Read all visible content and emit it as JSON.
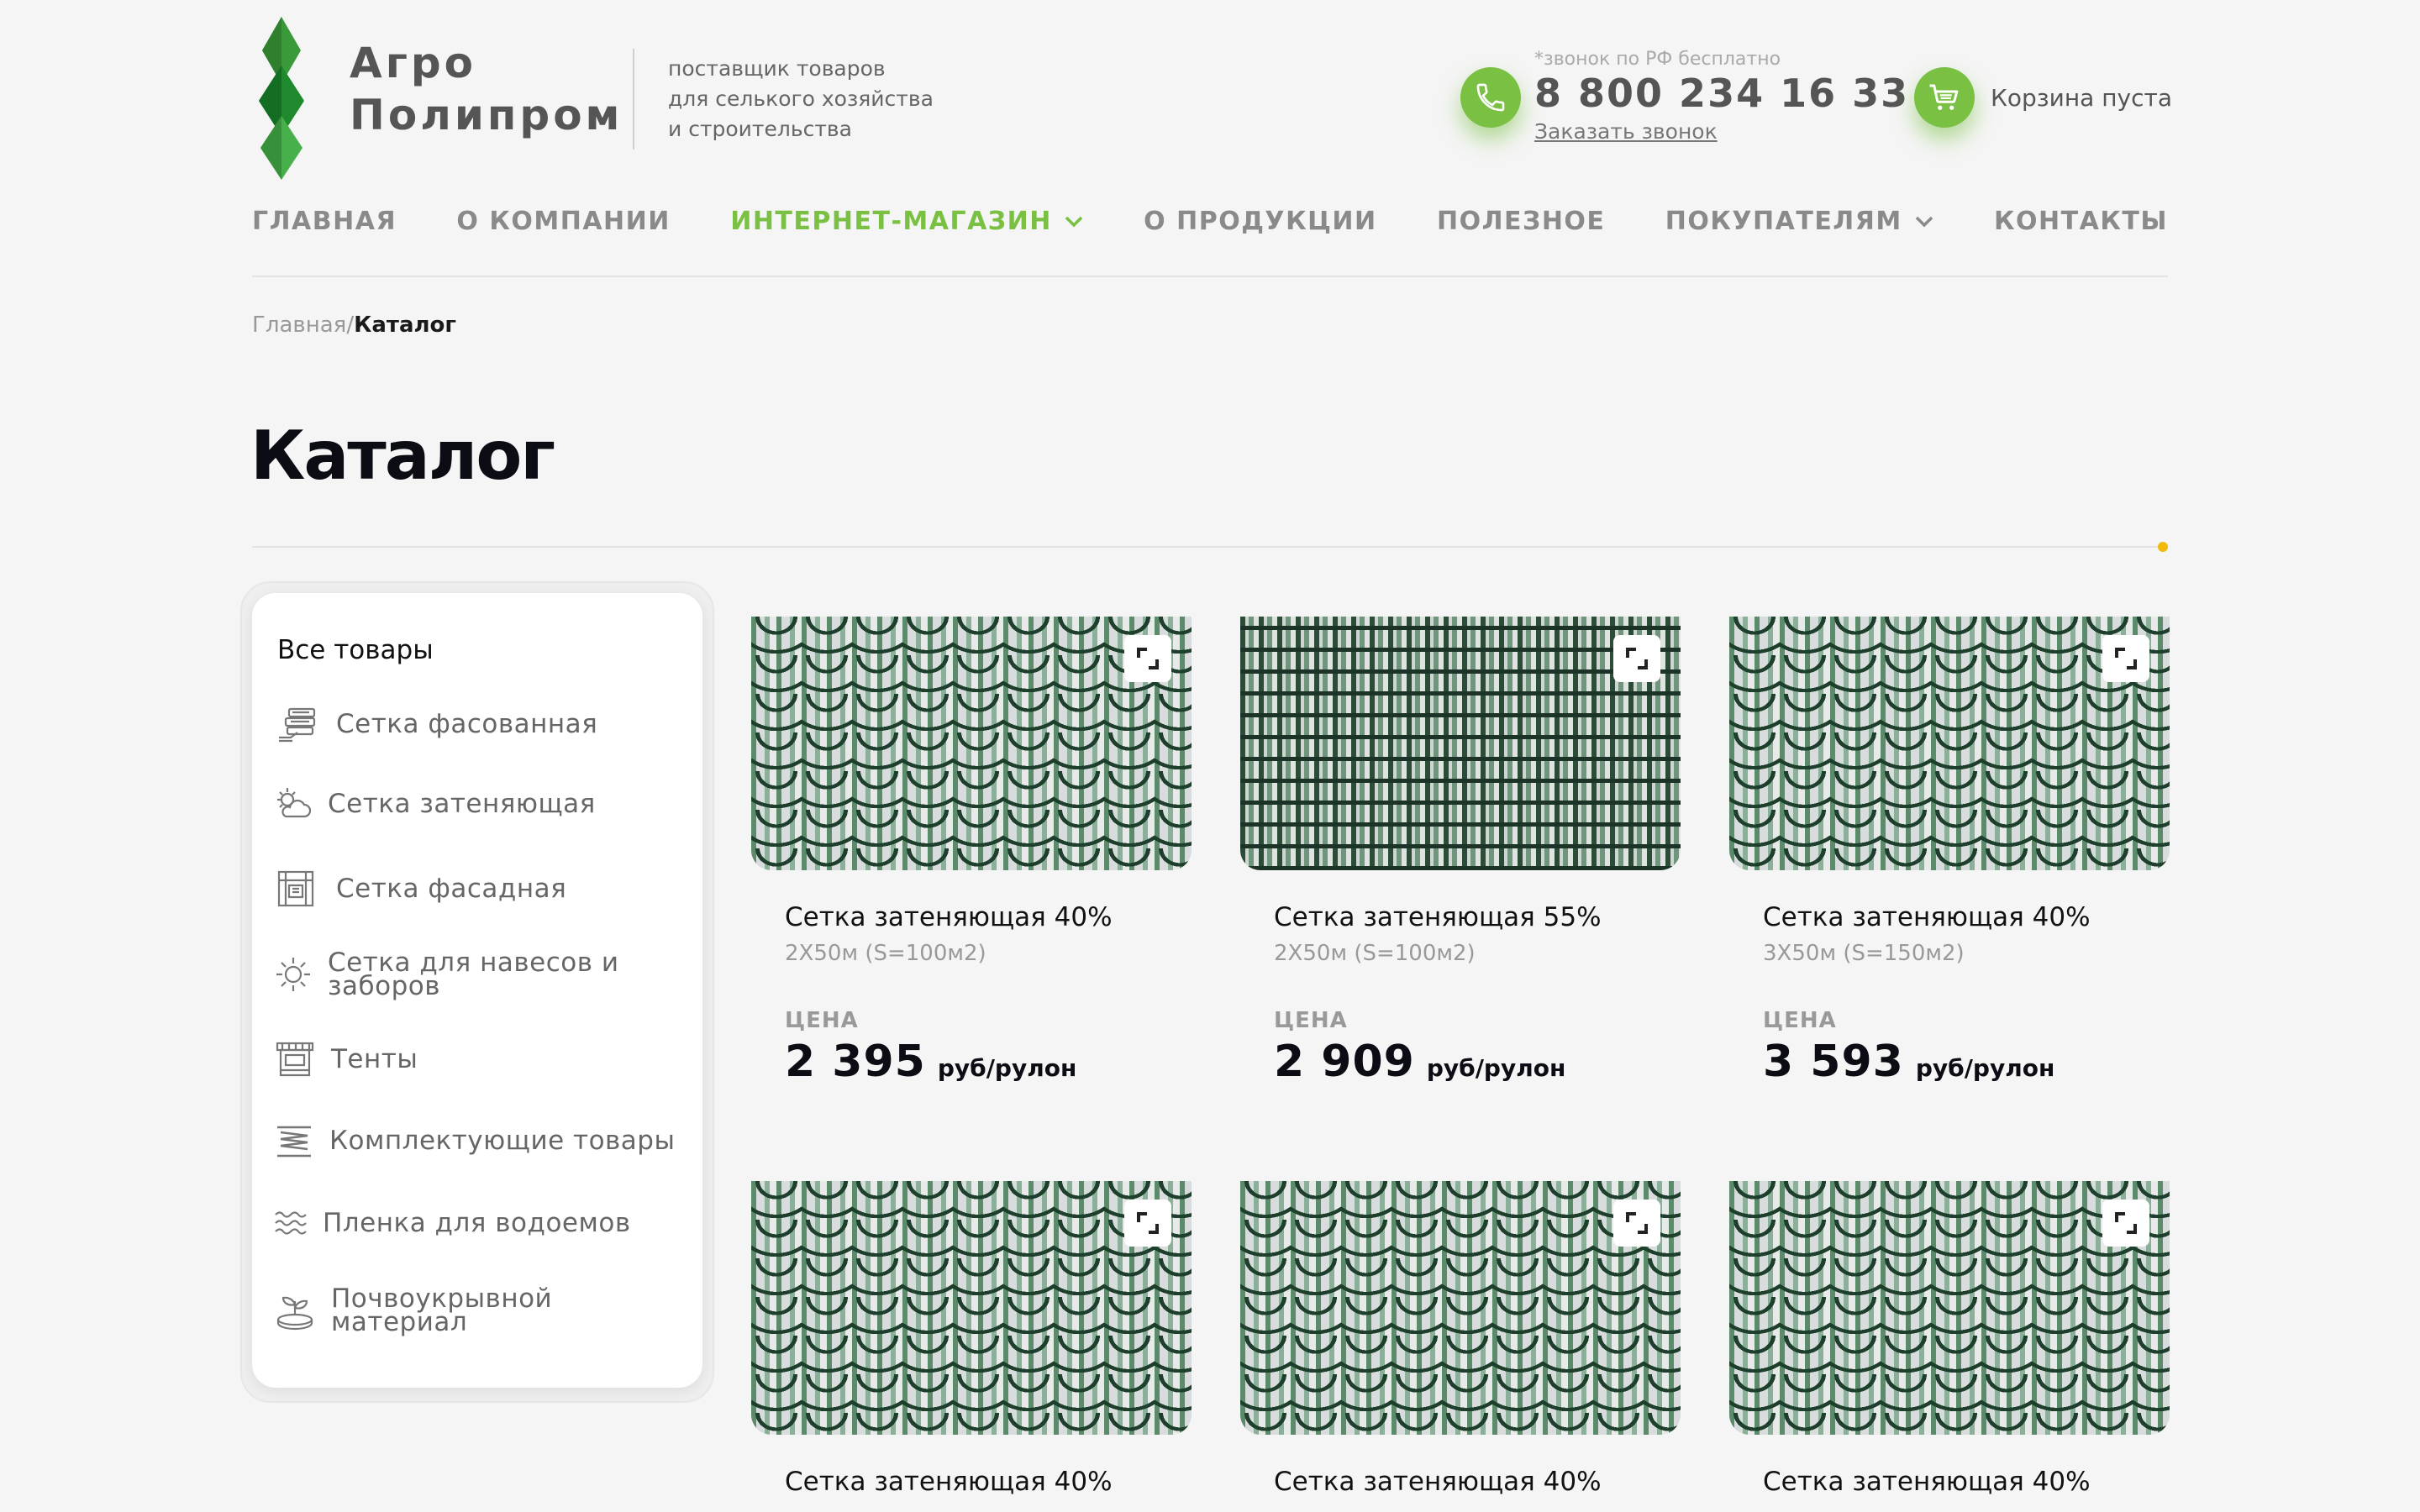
{
  "header": {
    "logo_line1": "Агро",
    "logo_line2": "Полипром",
    "tagline_1": "поставщик товаров",
    "tagline_2": "для селького хозяйства",
    "tagline_3": "и строительства",
    "phone_note": "*звонок по РФ бесплатно",
    "phone_number": "8 800 234 16 33",
    "callback": "Заказать звонок",
    "cart": "Корзина пуста"
  },
  "nav": [
    {
      "label": "ГЛАВНАЯ"
    },
    {
      "label": "О КОМПАНИИ"
    },
    {
      "label": "ИНТЕРНЕТ-МАГАЗИН"
    },
    {
      "label": "О ПРОДУКЦИИ"
    },
    {
      "label": "ПОЛЕЗНОЕ"
    },
    {
      "label": "ПОКУПАТЕЛЯМ"
    },
    {
      "label": "КОНТАКТЫ"
    }
  ],
  "breadcrumb": {
    "home": "Главная",
    "sep": "/",
    "current": "Каталог"
  },
  "page_title": "Каталог",
  "sidebar": {
    "all": "Все товары",
    "items": [
      {
        "label": "Сетка фасованная",
        "icon": "packaged-net-icon"
      },
      {
        "label": "Сетка затеняющая",
        "icon": "sun-cloud-icon"
      },
      {
        "label": "Сетка фасадная",
        "icon": "facade-icon"
      },
      {
        "label": "Сетка для навесов и заборов",
        "icon": "sun-icon"
      },
      {
        "label": "Тенты",
        "icon": "awning-icon"
      },
      {
        "label": "Комплектующие товары",
        "icon": "spring-icon"
      },
      {
        "label": "Пленка для водоемов",
        "icon": "water-icon"
      },
      {
        "label": "Почвоукрывной материал",
        "icon": "sprout-icon"
      }
    ]
  },
  "products": [
    {
      "name": "Сетка затеняющая 40%",
      "size": "2Х50м (S=100м2)",
      "price_label": "ЦЕНА",
      "price": "2 395",
      "unit": "руб/рулон"
    },
    {
      "name": "Сетка затеняющая 55%",
      "size": "2Х50м (S=100м2)",
      "price_label": "ЦЕНА",
      "price": "2 909",
      "unit": "руб/рулон"
    },
    {
      "name": "Сетка затеняющая 40%",
      "size": "3Х50м (S=150м2)",
      "price_label": "ЦЕНА",
      "price": "3 593",
      "unit": "руб/рулон"
    },
    {
      "name": "Сетка затеняющая 40%"
    },
    {
      "name": "Сетка затеняющая 40%"
    },
    {
      "name": "Сетка затеняющая 40%"
    }
  ],
  "colors": {
    "accent": "#79c043",
    "dot": "#f2b90a",
    "text_dark": "#0c0c14"
  }
}
